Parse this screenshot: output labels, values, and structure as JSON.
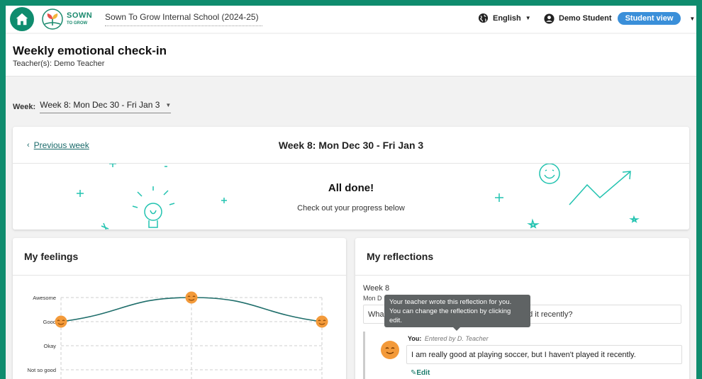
{
  "topbar": {
    "logo_line1": "SOWN",
    "logo_line2": "TO GROW",
    "school": "Sown To Grow Internal School (2024-25)",
    "language": "English",
    "user_name": "Demo Student",
    "view_label": "Student view"
  },
  "header": {
    "title": "Weekly emotional check-in",
    "teachers": "Teacher(s): Demo Teacher"
  },
  "week_selector": {
    "label": "Week:",
    "value": "Week 8: Mon Dec 30 - Fri Jan 3"
  },
  "week_card": {
    "prev_link": "Previous week",
    "title": "Week 8: Mon Dec 30 - Fri Jan 3",
    "done_title": "All done!",
    "done_subtitle": "Check out your progress below"
  },
  "feelings": {
    "title": "My feelings",
    "chart_data": {
      "type": "line",
      "y_categories": [
        "Awesome",
        "Good",
        "Okay",
        "Not so good"
      ],
      "x": [
        1,
        2,
        3
      ],
      "values": [
        "Good",
        "Awesome",
        "Good"
      ],
      "grid": true,
      "colors": {
        "line": "#1f6e6b",
        "marker": "#f39a3a"
      }
    }
  },
  "reflections": {
    "title": "My reflections",
    "week": "Week 8",
    "date": "Mon D",
    "question_start": "Wha",
    "question_end": "ed it recently?",
    "you_label": "You:",
    "entered_by": "Entered by D. Teacher",
    "answer": "I am really good at playing soccer, but I haven't played it recently.",
    "edit_label": "Edit"
  },
  "tooltip": {
    "line1": "Your teacher wrote this reflection for you.",
    "line2": "You can change the reflection by clicking",
    "line3": "edit."
  }
}
